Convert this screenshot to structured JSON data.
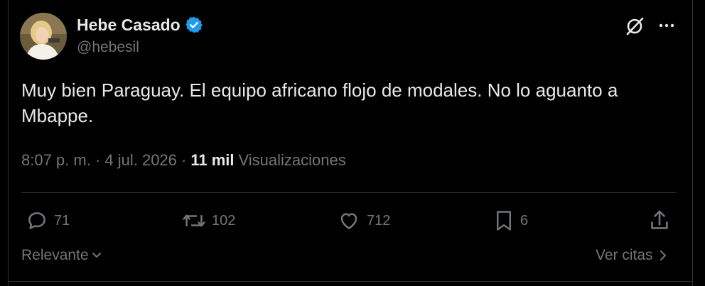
{
  "author": {
    "name": "Hebe Casado",
    "handle": "@hebesil",
    "verified_icon": "verified-badge-icon"
  },
  "tweet": {
    "text": "Muy bien Paraguay. El equipo africano flojo de modales. No lo aguanto a Mbappe.",
    "timestamp": "8:07 p. m. · 4 jul. 2026 ·",
    "views_count": "11 mil",
    "views_label": "Visualizaciones"
  },
  "actions": {
    "replies": "71",
    "reposts": "102",
    "likes": "712",
    "bookmarks": "6"
  },
  "footer": {
    "sort_label": "Relevante",
    "quotes_label": "Ver citas"
  },
  "colors": {
    "background": "#000000",
    "text": "#e7e9ea",
    "muted": "#71767b",
    "border": "#2f3336",
    "verified": "#1d9bf0"
  }
}
